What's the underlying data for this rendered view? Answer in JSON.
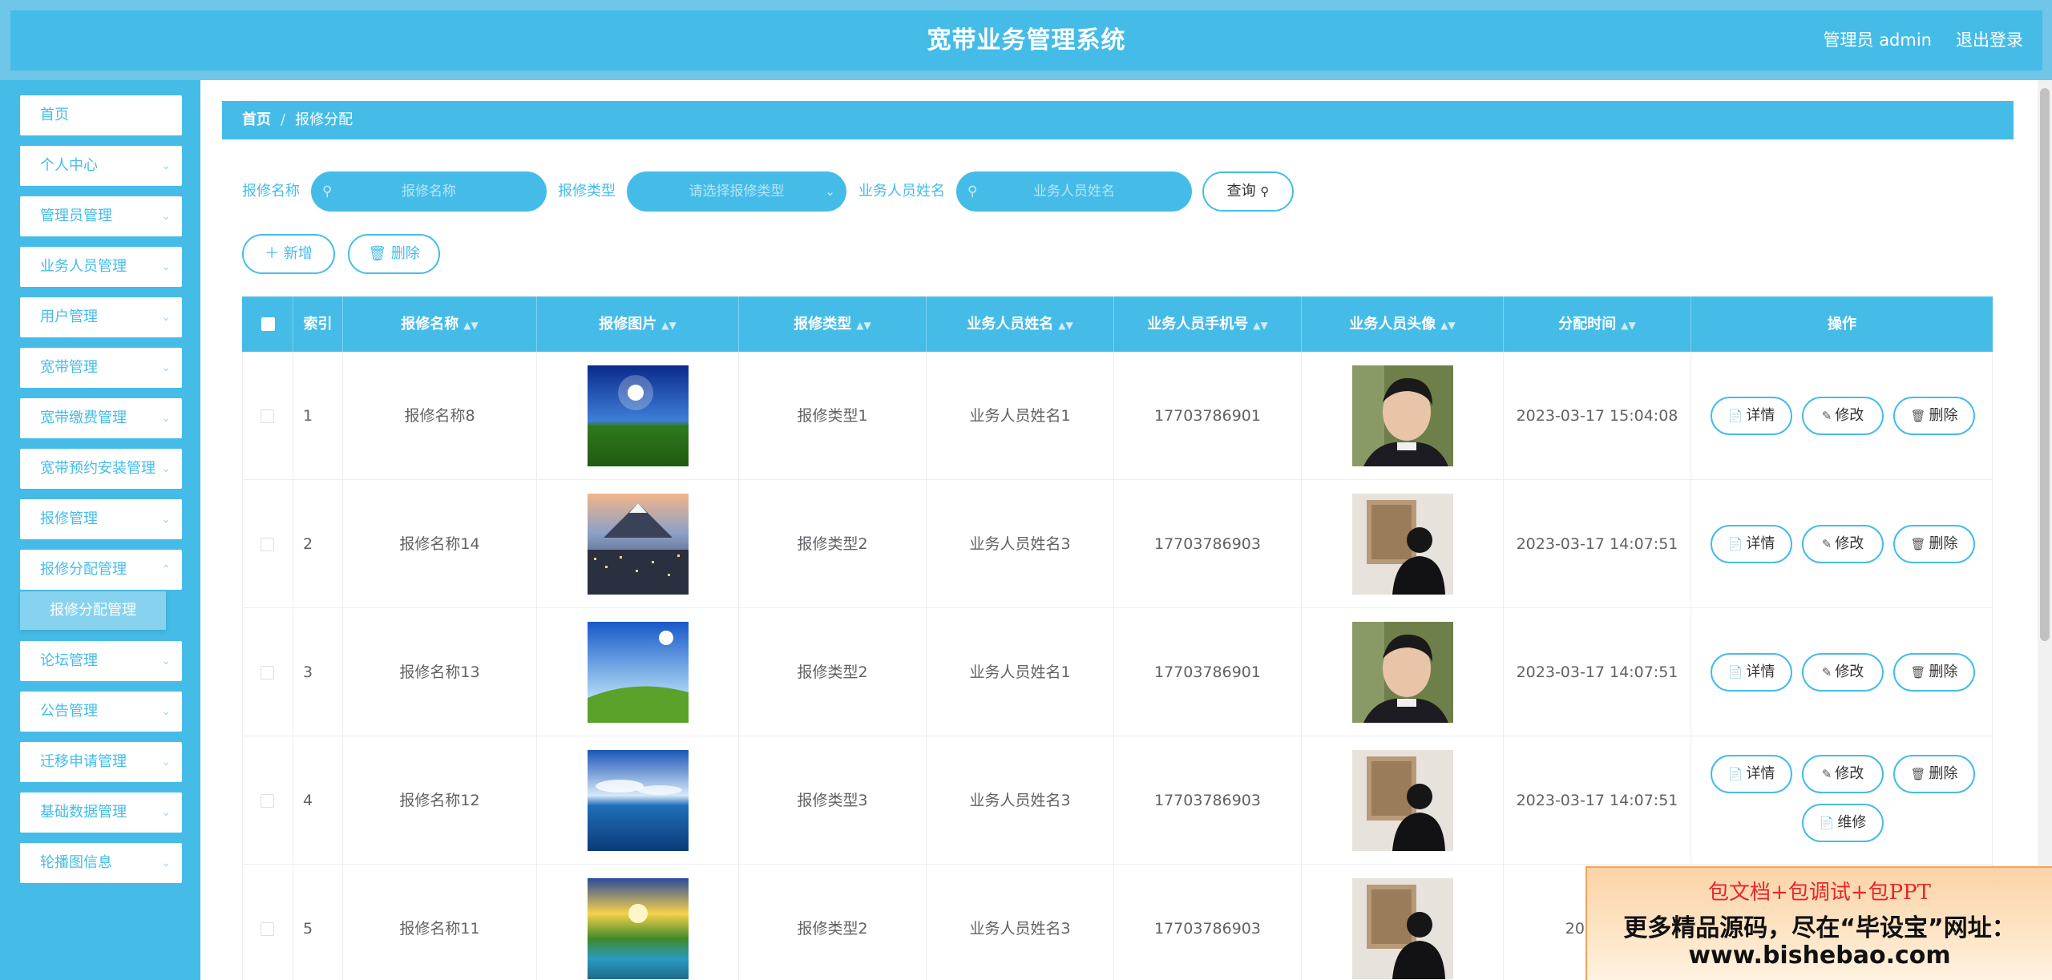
{
  "header": {
    "title": "宽带业务管理系统",
    "user": "管理员 admin",
    "logout": "退出登录"
  },
  "sidebar": {
    "items": [
      {
        "label": "首页"
      },
      {
        "label": "个人中心"
      },
      {
        "label": "管理员管理"
      },
      {
        "label": "业务人员管理"
      },
      {
        "label": "用户管理"
      },
      {
        "label": "宽带管理"
      },
      {
        "label": "宽带缴费管理"
      },
      {
        "label": "宽带预约安装管理"
      },
      {
        "label": "报修管理"
      },
      {
        "label": "报修分配管理"
      },
      {
        "label": "论坛管理"
      },
      {
        "label": "公告管理"
      },
      {
        "label": "迁移申请管理"
      },
      {
        "label": "基础数据管理"
      },
      {
        "label": "轮播图信息"
      }
    ],
    "submenu_active": "报修分配管理"
  },
  "breadcrumb": {
    "home": "首页",
    "separator": "/",
    "current": "报修分配"
  },
  "search": {
    "name_label": "报修名称",
    "name_placeholder": "报修名称",
    "type_label": "报修类型",
    "type_placeholder": "请选择报修类型",
    "staff_label": "业务人员姓名",
    "staff_placeholder": "业务人员姓名",
    "query_button": "查询"
  },
  "actions": {
    "add": "新增",
    "delete": "删除"
  },
  "table": {
    "headers": [
      "索引",
      "报修名称",
      "报修图片",
      "报修类型",
      "业务人员姓名",
      "业务人员手机号",
      "业务人员头像",
      "分配时间",
      "操作"
    ],
    "rows": [
      {
        "index": "1",
        "name": "报修名称8",
        "type": "报修类型1",
        "staff": "业务人员姓名1",
        "phone": "17703786901",
        "time": "2023-03-17 15:04:08",
        "image": "sky-grass",
        "avatar": "man-portrait"
      },
      {
        "index": "2",
        "name": "报修名称14",
        "type": "报修类型2",
        "staff": "业务人员姓名3",
        "phone": "17703786903",
        "time": "2023-03-17 14:07:51",
        "image": "city-mountain",
        "avatar": "man-back"
      },
      {
        "index": "3",
        "name": "报修名称13",
        "type": "报修类型2",
        "staff": "业务人员姓名1",
        "phone": "17703786901",
        "time": "2023-03-17 14:07:51",
        "image": "sky-field",
        "avatar": "man-portrait"
      },
      {
        "index": "4",
        "name": "报修名称12",
        "type": "报修类型3",
        "staff": "业务人员姓名3",
        "phone": "17703786903",
        "time": "2023-03-17 14:07:51",
        "image": "sea-sky",
        "avatar": "man-back",
        "extra_op": "维修"
      },
      {
        "index": "5",
        "name": "报修名称11",
        "type": "报修类型2",
        "staff": "业务人员姓名3",
        "phone": "17703786903",
        "time": "2023-03",
        "image": "sunset-lake",
        "avatar": "man-back"
      }
    ],
    "ops": {
      "detail": "详情",
      "edit": "修改",
      "delete": "删除"
    }
  },
  "ad": {
    "line1": "包文档+包调试+包PPT",
    "line2": "更多精品源码，尽在“毕设宝”网址：",
    "line3": "www.bishebao.com"
  },
  "colors": {
    "primary": "#45bce8",
    "header_bg": "#6fc6e8",
    "submenu": "#87d3ef"
  }
}
